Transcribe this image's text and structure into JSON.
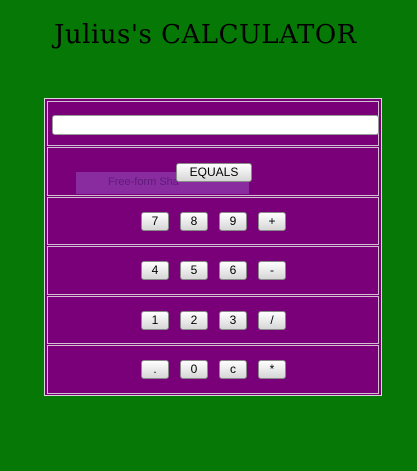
{
  "title": "Julius's CALCULATOR",
  "display": {
    "value": ""
  },
  "equals_label": "EQUALS",
  "freeform_label": "Free-form Sha",
  "keypad": [
    [
      "7",
      "8",
      "9",
      "+"
    ],
    [
      "4",
      "5",
      "6",
      "-"
    ],
    [
      "1",
      "2",
      "3",
      "/"
    ],
    [
      ".",
      "0",
      "c",
      "*"
    ]
  ]
}
